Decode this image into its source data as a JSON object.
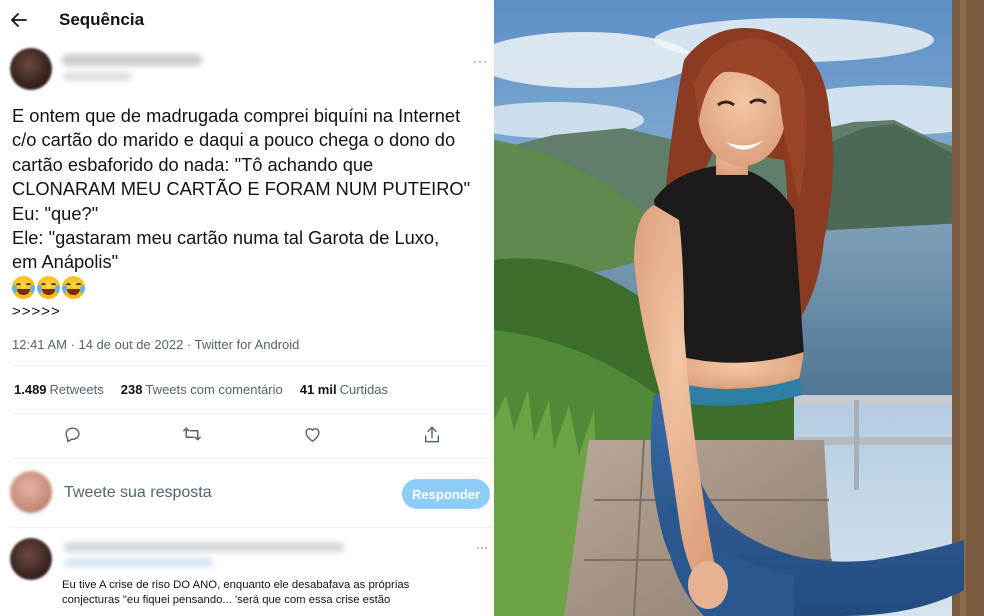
{
  "header": {
    "back_icon": "arrow-left-icon",
    "title": "Sequência"
  },
  "tweet": {
    "more_icon": "more-dots-icon",
    "text_lines": [
      "E ontem que de madrugada comprei biquíni na Internet",
      "c/o cartão do marido e daqui a pouco chega o dono do",
      "cartão esbaforido do nada: \"Tô achando que",
      "CLONARAM MEU CARTÃO E FORAM NUM PUTEIRO\"",
      "Eu: \"que?\"",
      "Ele: \"gastaram meu cartão numa tal Garota de Luxo,",
      "em Anápolis\""
    ],
    "emojis": [
      "face-with-tears-of-joy",
      "face-with-tears-of-joy",
      "face-with-tears-of-joy"
    ],
    "trailing": ">>>>>",
    "meta": "12:41 AM · 14 de out de 2022 · Twitter for Android",
    "stats": {
      "retweets_count": "1.489",
      "retweets_label": "Retweets",
      "comments_count": "238",
      "comments_label": "Tweets com comentário",
      "likes_count": "41 mil",
      "likes_label": "Curtidas"
    },
    "actions": [
      "reply-icon",
      "retweet-icon",
      "like-icon",
      "share-icon"
    ]
  },
  "reply_box": {
    "placeholder": "Tweete sua resposta",
    "button_label": "Responder",
    "button_color": "#8ecdf8"
  },
  "comment": {
    "text_line1": "Eu tive A crise de riso DO ANO, enquanto ele desabafava as próprias",
    "text_line2": "conjecturas \"eu fiquei pensando... 'será que com essa crise estão"
  },
  "colors": {
    "text_primary": "#0f1419",
    "text_secondary": "#536471",
    "accent": "#1d9bf0"
  }
}
